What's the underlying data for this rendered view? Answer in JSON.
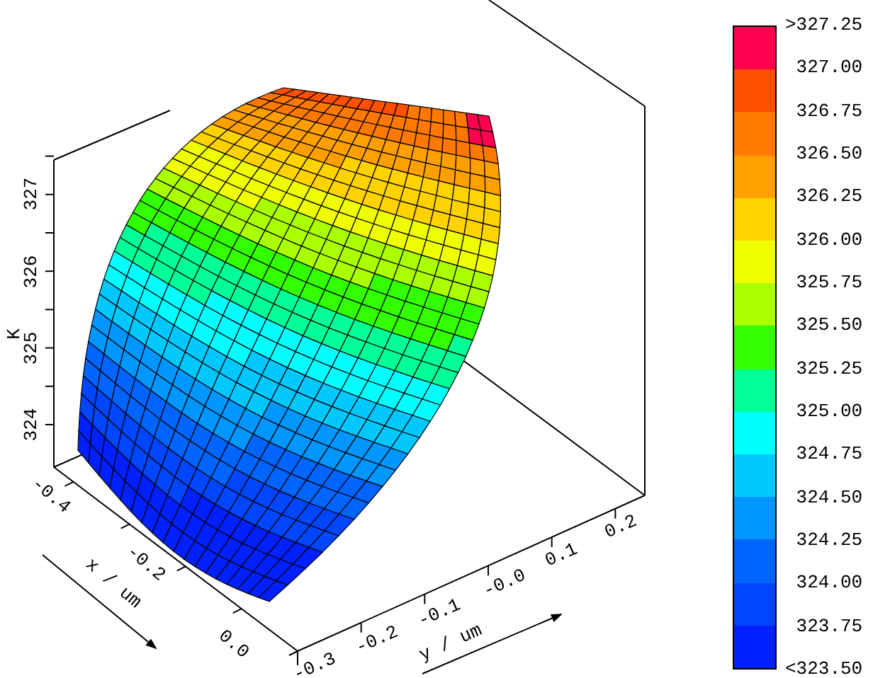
{
  "plot": {
    "z_axis": {
      "label": "K",
      "ticks": [
        "324",
        "325",
        "326",
        "327"
      ]
    },
    "x_axis": {
      "label": "x / um",
      "ticks": [
        "-0.4",
        "-0.2",
        "0.0"
      ]
    },
    "y_axis": {
      "label": "y / um",
      "ticks": [
        "-0.3",
        "-0.2",
        "-0.1",
        "-0.0",
        "0.1",
        "0.2"
      ]
    }
  },
  "colorbar": {
    "bands": [
      {
        "color": "#ff0050"
      },
      {
        "color": "#ff5000"
      },
      {
        "color": "#ff7800"
      },
      {
        "color": "#ffa000"
      },
      {
        "color": "#ffd200"
      },
      {
        "color": "#f0ff00"
      },
      {
        "color": "#aaff00"
      },
      {
        "color": "#32ff00"
      },
      {
        "color": "#00ff96"
      },
      {
        "color": "#00ffff"
      },
      {
        "color": "#00c8ff"
      },
      {
        "color": "#0096ff"
      },
      {
        "color": "#0064ff"
      },
      {
        "color": "#0046ff"
      },
      {
        "color": "#0020ff"
      }
    ],
    "labels": [
      ">327.25",
      "327.00",
      "326.75",
      "326.50",
      "326.25",
      "326.00",
      "325.75",
      "325.50",
      "325.25",
      "325.00",
      "324.75",
      "324.50",
      "324.25",
      "324.00",
      "323.75",
      "<323.50"
    ]
  }
}
